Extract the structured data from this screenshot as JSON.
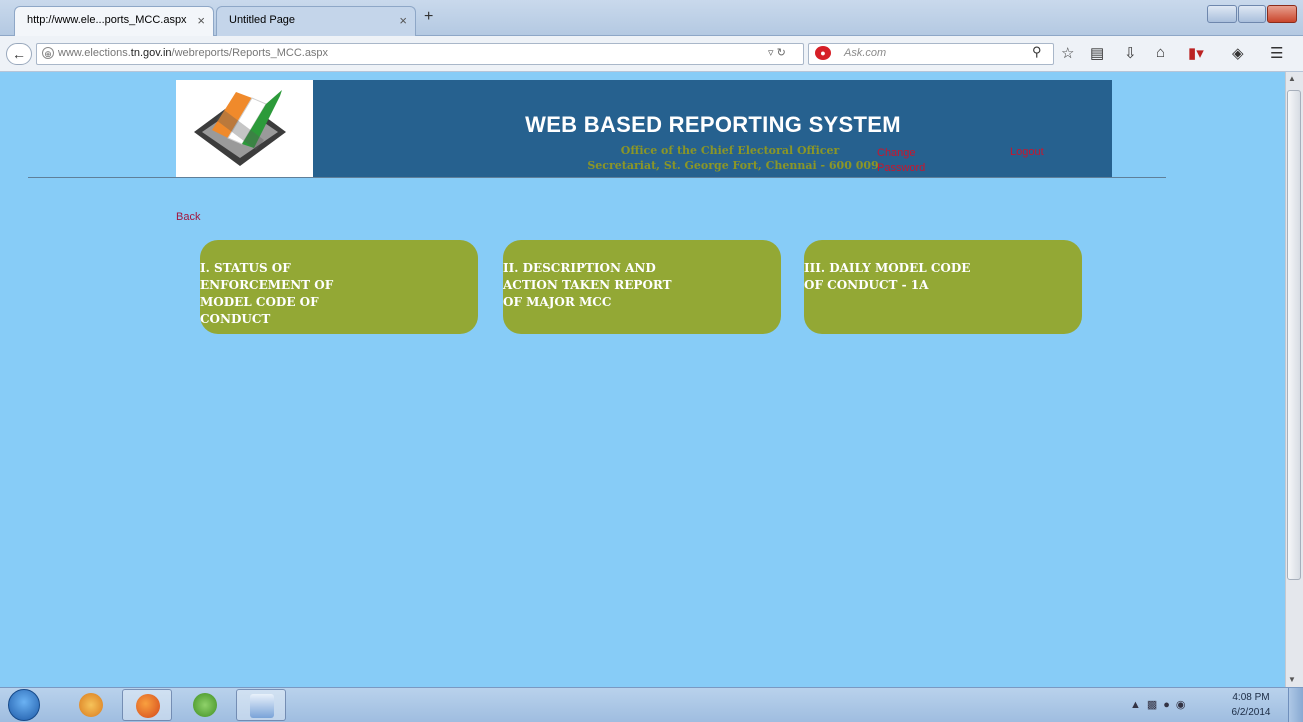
{
  "browser": {
    "tabs": [
      {
        "title": "http://www.ele...ports_MCC.aspx",
        "active": true
      },
      {
        "title": "Untitled Page",
        "active": false
      }
    ],
    "new_tab": "+",
    "tab_close": "×",
    "url_prefix": "www.elections.",
    "url_domain": "tn.gov.in",
    "url_path": "/webreports/Reports_MCC.aspx",
    "search_placeholder": "Ask.com"
  },
  "header": {
    "title": "WEB BASED REPORTING SYSTEM",
    "subtitle1": "Office of the Chief Electoral Officer",
    "subtitle2": "Secretariat, St. George Fort, Chennai - 600 009",
    "change_password": "Change Password",
    "logout": "Logout"
  },
  "back_label": "Back",
  "cards": [
    {
      "label": "I. STATUS OF ENFORCEMENT OF MODEL CODE OF CONDUCT"
    },
    {
      "label": "II. DESCRIPTION AND ACTION TAKEN REPORT OF MAJOR MCC"
    },
    {
      "label": "III. DAILY MODEL CODE OF CONDUCT - 1A"
    }
  ],
  "colors": {
    "page_bg": "#87CCF7",
    "banner_bg": "#26618F",
    "card_bg": "#93A835",
    "link_red": "#C8162E"
  },
  "taskbar": {
    "time": "4:08 PM",
    "date": "6/2/2014"
  }
}
